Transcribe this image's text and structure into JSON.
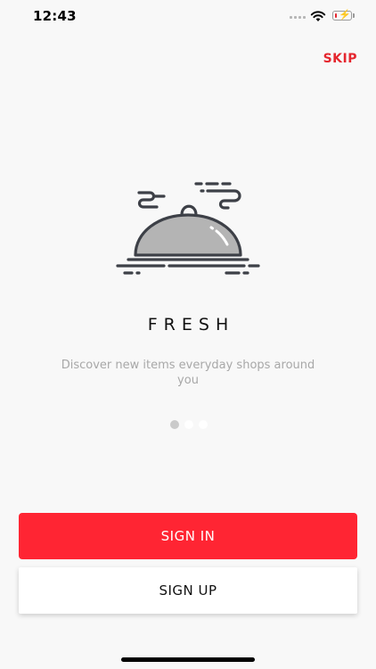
{
  "status_bar": {
    "time": "12:43",
    "icons": [
      "signal-icon",
      "wifi-icon",
      "battery-icon"
    ],
    "battery_level": 0.15
  },
  "header": {
    "skip_label": "SKIP"
  },
  "onboarding": {
    "illustration": "serving-cloche-icon",
    "title": "FRESH",
    "subtitle": "Discover new items everyday shops around you",
    "page_indicator": {
      "pages": 3,
      "current": 1
    }
  },
  "actions": {
    "sign_in_label": "SIGN IN",
    "sign_up_label": "SIGN UP"
  },
  "colors": {
    "accent": "#ff2533",
    "skip": "#e5262e",
    "background": "#f8f8f8",
    "subtitle": "#a8a8a8"
  }
}
